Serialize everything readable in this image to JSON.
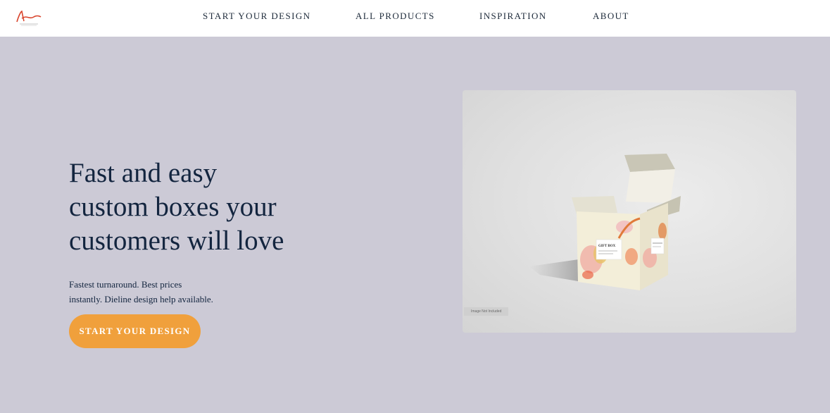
{
  "brand": {
    "logo_icon": "brand-logo-icon",
    "accent": "#d9452d"
  },
  "nav": {
    "items": [
      {
        "label": "START YOUR DESIGN"
      },
      {
        "label": "ALL PRODUCTS"
      },
      {
        "label": "INSPIRATION"
      },
      {
        "label": "ABOUT"
      }
    ]
  },
  "hero": {
    "title_lines": [
      "Fast and easy",
      "custom boxes your",
      "customers will love"
    ],
    "subtitle_lines": [
      "Fastest turnaround. Best prices",
      "instantly. Dieline design help available."
    ],
    "cta_label": "START YOUR DESIGN",
    "cta_color": "#f0a03c"
  },
  "product_image": {
    "box_label": "GIFT BOX",
    "caption": "Image Not Included"
  },
  "colors": {
    "background": "#cccad6",
    "header": "#ffffff",
    "text": "#13253f"
  }
}
